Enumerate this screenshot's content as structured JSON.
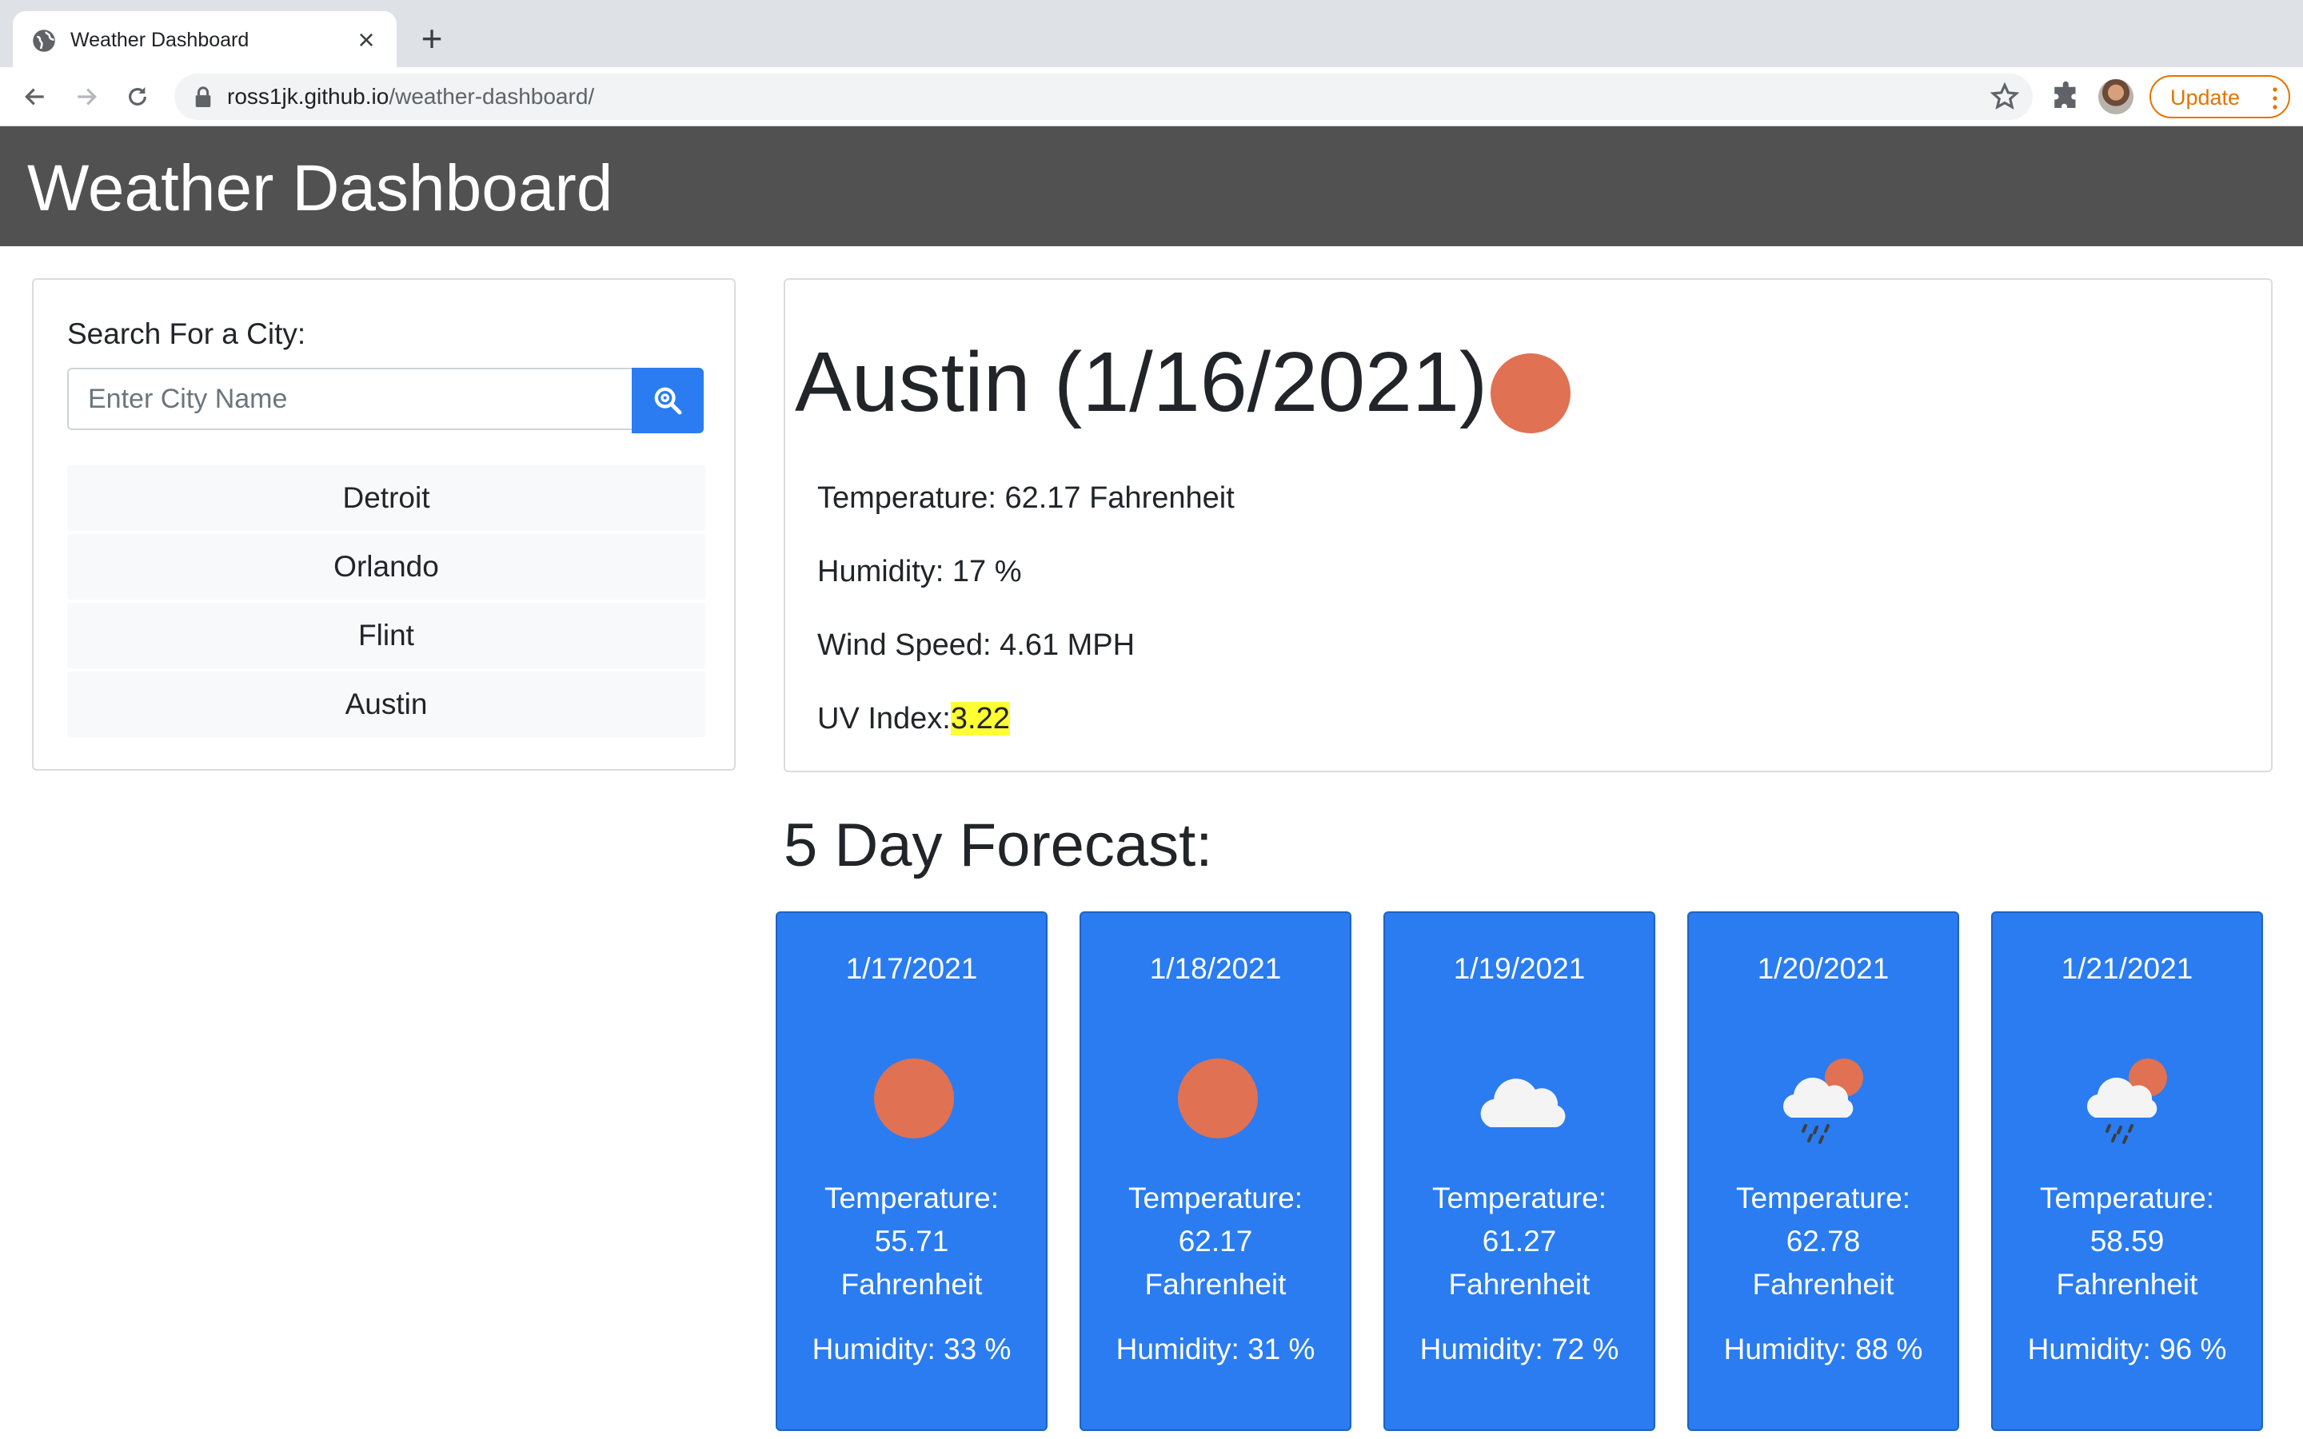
{
  "browser": {
    "tab_title": "Weather Dashboard",
    "url_host": "ross1jk.github.io",
    "url_path": "/weather-dashboard/",
    "update_label": "Update"
  },
  "app": {
    "title": "Weather Dashboard"
  },
  "search": {
    "label": "Search For a City:",
    "placeholder": "Enter City Name",
    "value": "",
    "history": [
      "Detroit",
      "Orlando",
      "Flint",
      "Austin"
    ]
  },
  "current": {
    "heading": "Austin (1/16/2021)",
    "icon": "sun-icon",
    "temperature": "Temperature: 62.17 Fahrenheit",
    "humidity": "Humidity: 17 %",
    "wind": "Wind Speed: 4.61 MPH",
    "uv_label": "UV Index:",
    "uv_value": "3.22",
    "uv_color": "#ffff33"
  },
  "forecast": {
    "title": "5 Day Forecast:",
    "card_color": "#2a7cf0",
    "days": [
      {
        "date": "1/17/2021",
        "icon": "sun-icon",
        "temp_label": "Temperature:",
        "temp_value": "55.71",
        "temp_unit": "Fahrenheit",
        "humidity": "Humidity: 33 %"
      },
      {
        "date": "1/18/2021",
        "icon": "sun-icon",
        "temp_label": "Temperature:",
        "temp_value": "62.17",
        "temp_unit": "Fahrenheit",
        "humidity": "Humidity: 31 %"
      },
      {
        "date": "1/19/2021",
        "icon": "cloud-icon",
        "temp_label": "Temperature:",
        "temp_value": "61.27",
        "temp_unit": "Fahrenheit",
        "humidity": "Humidity: 72 %"
      },
      {
        "date": "1/20/2021",
        "icon": "rain-sun-icon",
        "temp_label": "Temperature:",
        "temp_value": "62.78",
        "temp_unit": "Fahrenheit",
        "humidity": "Humidity: 88 %"
      },
      {
        "date": "1/21/2021",
        "icon": "rain-sun-icon",
        "temp_label": "Temperature:",
        "temp_value": "58.59",
        "temp_unit": "Fahrenheit",
        "humidity": "Humidity: 96 %"
      }
    ]
  }
}
